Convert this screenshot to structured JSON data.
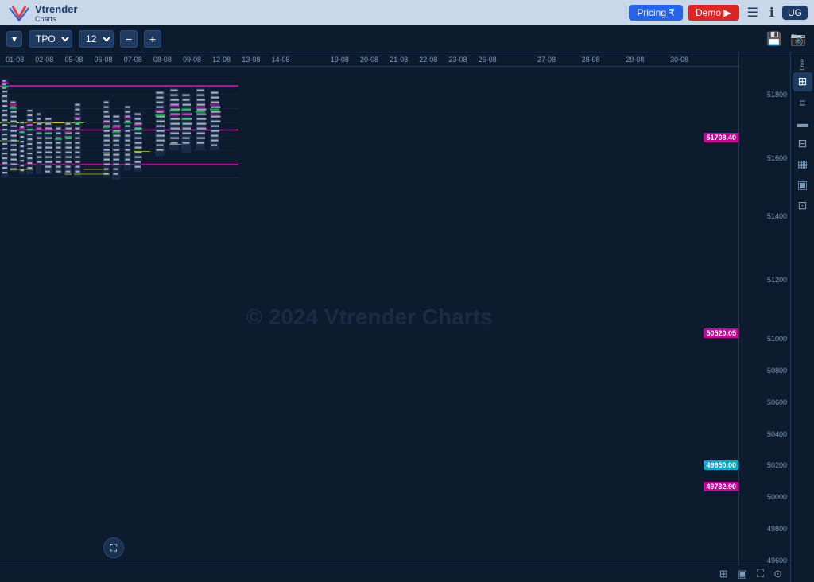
{
  "topbar": {
    "logo_text": "Vtrender",
    "logo_sub": "Charts",
    "pricing_label": "Pricing ₹",
    "demo_label": "Demo ▶",
    "menu_icon": "☰",
    "info_icon": "ℹ",
    "avatar": "UG"
  },
  "toolbar": {
    "dropdown_label": "TPO",
    "interval_value": "12",
    "minus_label": "−",
    "plus_label": "+",
    "save_icon": "💾",
    "camera_icon": "📷"
  },
  "chart": {
    "watermark": "© 2024 Vtrender Charts",
    "time_labels": [
      "01-08",
      "02-08",
      "05-08",
      "06-08",
      "07-08",
      "08-08",
      "09-08",
      "12-08",
      "13-08",
      "14-08",
      "19-08",
      "20-08",
      "21-08",
      "22-08",
      "23-08",
      "26-08",
      "27-08",
      "28-08",
      "29-08",
      "30-08"
    ],
    "price_labels": [
      "51800",
      "51600",
      "51400",
      "51200",
      "51000",
      "50800",
      "50600",
      "50400",
      "50200",
      "50000",
      "49800",
      "49600"
    ],
    "highlighted_prices": [
      {
        "value": "51708.40",
        "color": "magenta",
        "top_pct": 17.5
      },
      {
        "value": "50520.05",
        "color": "magenta",
        "top_pct": 55.0
      },
      {
        "value": "49950.00",
        "color": "cyan",
        "top_pct": 77.5
      },
      {
        "value": "49732.90",
        "color": "magenta",
        "top_pct": 83.5
      }
    ],
    "magenta_lines": [
      {
        "top_pct": 17.5
      },
      {
        "top_pct": 55.0
      },
      {
        "top_pct": 83.5
      }
    ]
  },
  "sidebar": {
    "live_label": "Live",
    "icons": [
      "⊞",
      "≡",
      "▬",
      "⊟",
      "▦",
      "▣",
      "⊡"
    ]
  },
  "bottom_bar": {
    "icons": [
      "⊞",
      "▣",
      "⛶",
      "⊙"
    ]
  }
}
